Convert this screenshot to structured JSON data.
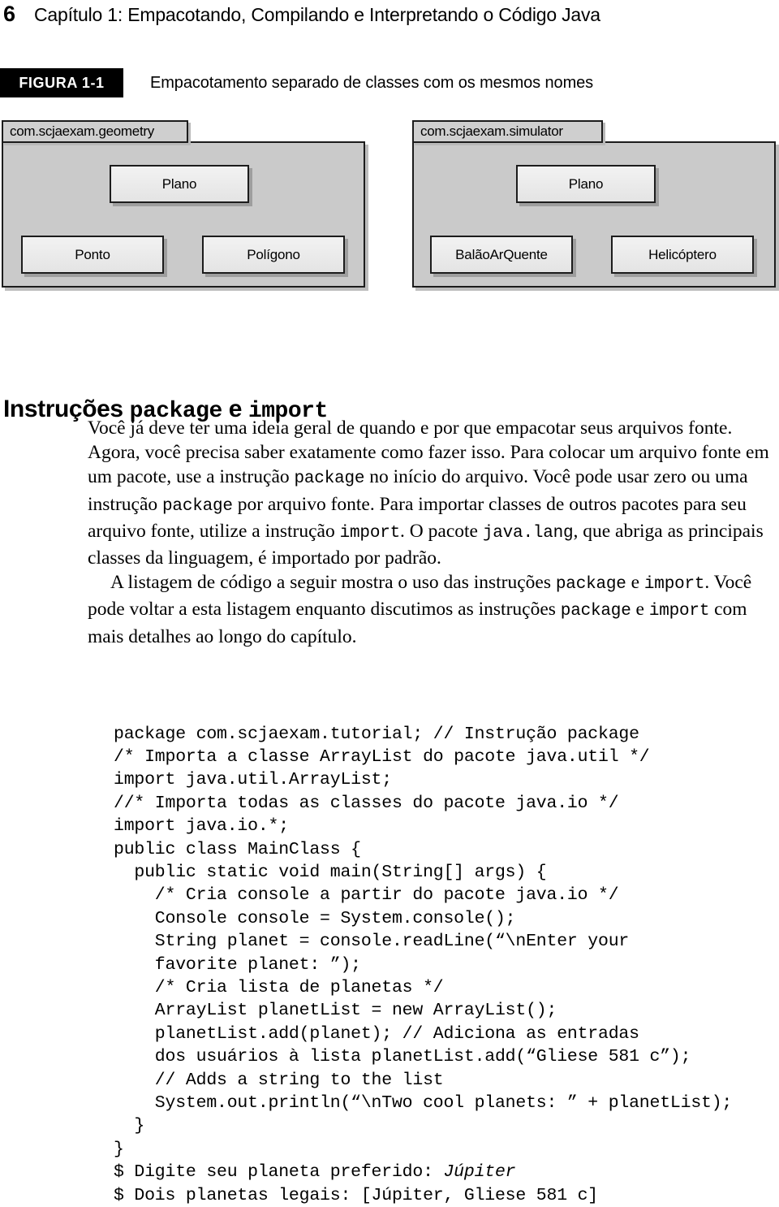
{
  "running_head": {
    "page_number": "6",
    "chapter_title": "Capítulo 1: Empacotando, Compilando e Interpretando o Código Java"
  },
  "figure": {
    "badge_label": "FIGURA 1-1",
    "caption": "Empacotamento separado de classes com os mesmos nomes",
    "packages": [
      {
        "name": "com.scjaexam.geometry",
        "classes": [
          "Plano",
          "Ponto",
          "Polígono"
        ]
      },
      {
        "name": "com.scjaexam.simulator",
        "classes": [
          "Plano",
          "BalãoArQuente",
          "Helicóptero"
        ]
      }
    ]
  },
  "section": {
    "heading_prefix": "Instruções ",
    "heading_mono_1": "package",
    "heading_middle": " e ",
    "heading_mono_2": "import",
    "paragraph_1": {
      "t1": "Você já deve ter uma ideia geral de quando e por que empacotar seus arquivos fonte. Agora, você precisa saber exatamente como fazer isso. Para colocar um arquivo fonte em um pacote, use a instrução ",
      "m1": "package",
      "t2": " no início do arquivo. Você pode usar zero ou uma instrução ",
      "m2": "package",
      "t3": " por arquivo fonte. Para importar classes de outros pacotes para seu arquivo fonte, utilize a instrução ",
      "m3": "import",
      "t4": ". O pacote ",
      "m4": "java.lang",
      "t5": ", que abriga as principais classes da linguagem, é importado por padrão."
    },
    "paragraph_2": {
      "t1": "A listagem de código a seguir mostra o uso das instruções ",
      "m1": "package",
      "t2": " e ",
      "m2": "import",
      "t3": ". Você pode voltar a esta listagem enquanto discutimos as instruções ",
      "m3": "package",
      "t4": " e ",
      "m4": "import",
      "t5": " com mais detalhes ao longo do capítulo."
    }
  },
  "code": {
    "lines_before_italic": "package com.scjaexam.tutorial; // Instrução package\n/* Importa a classe ArrayList do pacote java.util */\nimport java.util.ArrayList;\n//* Importa todas as classes do pacote java.io */\nimport java.io.*;\npublic class MainClass {\n  public static void main(String[] args) {\n    /* Cria console a partir do pacote java.io */\n    Console console = System.console();\n    String planet = console.readLine(“\\nEnter your\n    favorite planet: ”);\n    /* Cria lista de planetas */\n    ArrayList planetList = new ArrayList();\n    planetList.add(planet); // Adiciona as entradas\n    dos usuários à lista planetList.add(“Gliese 581 c”);\n    // Adds a string to the list\n    System.out.println(“\\nTwo cool planets: ” + planetList);\n  }\n}\n$ Digite seu planeta preferido: ",
    "italic_value": "Júpiter",
    "lines_after_italic": "\n$ Dois planetas legais: [Júpiter, Gliese 581 c]"
  }
}
